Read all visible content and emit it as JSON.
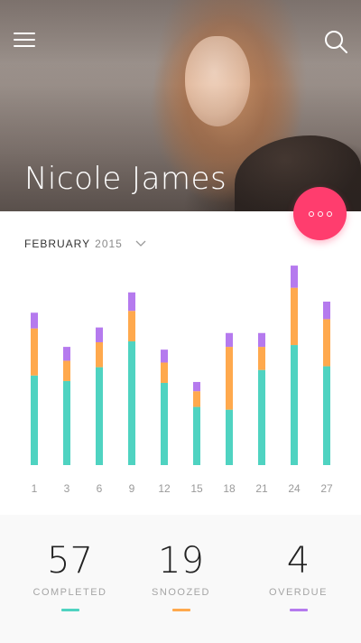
{
  "header": {
    "profile_name": "Nicole James",
    "menu_icon": "hamburger-menu-icon",
    "search_icon": "search-icon",
    "fab_icon": "more-dots-icon",
    "fab_color": "#ff3d6e"
  },
  "month_selector": {
    "month": "FEBRUARY",
    "year": "2015",
    "icon": "chevron-down-icon"
  },
  "chart_data": {
    "type": "bar",
    "stacked": true,
    "categories": [
      "1",
      "3",
      "6",
      "9",
      "12",
      "15",
      "18",
      "21",
      "24",
      "27"
    ],
    "series": [
      {
        "name": "COMPLETED",
        "color": "#4fd3c1",
        "values": [
          97,
          91,
          106,
          134,
          89,
          63,
          60,
          103,
          130,
          107
        ]
      },
      {
        "name": "SNOOZED",
        "color": "#ffa94d",
        "values": [
          51,
          22,
          27,
          33,
          22,
          17,
          68,
          25,
          62,
          51
        ]
      },
      {
        "name": "OVERDUE",
        "color": "#b57aee",
        "values": [
          17,
          15,
          16,
          20,
          14,
          10,
          15,
          15,
          24,
          19
        ]
      }
    ],
    "ylim": [
      0,
      220
    ],
    "grid": false,
    "legend": "none"
  },
  "stats": [
    {
      "value": "57",
      "label": "COMPLETED",
      "color": "#4fd3c1"
    },
    {
      "value": "19",
      "label": "SNOOZED",
      "color": "#ffa94d"
    },
    {
      "value": "4",
      "label": "OVERDUE",
      "color": "#b57aee"
    }
  ]
}
